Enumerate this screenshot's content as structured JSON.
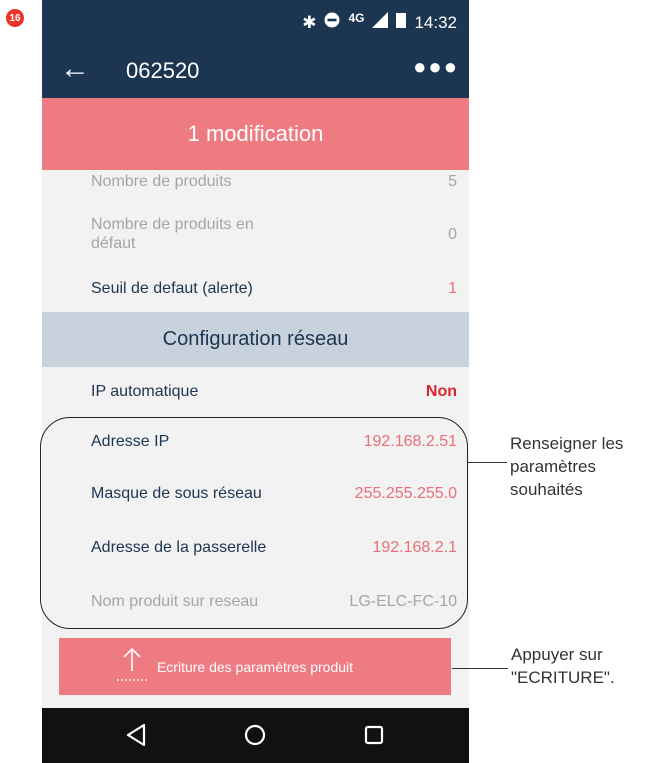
{
  "step_badge": "16",
  "status_bar": {
    "network": "4G",
    "time": "14:32"
  },
  "app_bar": {
    "title": "062520"
  },
  "banner": "1 modification",
  "rows_top": [
    {
      "label": "Nombre de produits",
      "value": "5"
    },
    {
      "label": "Nombre de produits en défaut",
      "value": "0"
    },
    {
      "label": "Seuil de defaut (alerte)",
      "value": "1"
    }
  ],
  "section_title": "Configuration réseau",
  "network_rows": [
    {
      "label": "IP automatique",
      "value": "Non"
    },
    {
      "label": "Adresse IP",
      "value": "192.168.2.51"
    },
    {
      "label": "Masque de sous réseau",
      "value": "255.255.255.0"
    },
    {
      "label": "Adresse de la passerelle",
      "value": "192.168.2.1"
    },
    {
      "label": "Nom produit sur reseau",
      "value": "LG-ELC-FC-10"
    }
  ],
  "write_button": "Ecriture des paramètres produit",
  "annotations": {
    "params": "Renseigner les\nparamètres\nsouhaités",
    "write": "Appuyer sur\n\"ECRITURE\"."
  },
  "icons": {
    "bluetooth": "bluetooth-icon",
    "dnd": "do-not-disturb-icon",
    "signal": "signal-icon",
    "battery": "battery-icon",
    "back": "back-arrow-icon",
    "more": "more-dots-icon",
    "upload": "upload-arrow-icon",
    "nav_back": "nav-back-triangle-icon",
    "nav_home": "nav-home-circle-icon",
    "nav_recents": "nav-recents-square-icon"
  },
  "colors": {
    "header": "#1c3550",
    "banner": "#ee7b82",
    "section": "#c8d2dc",
    "value_pink": "#ea6f78",
    "value_red": "#d9252e",
    "badge": "#e8342a"
  }
}
